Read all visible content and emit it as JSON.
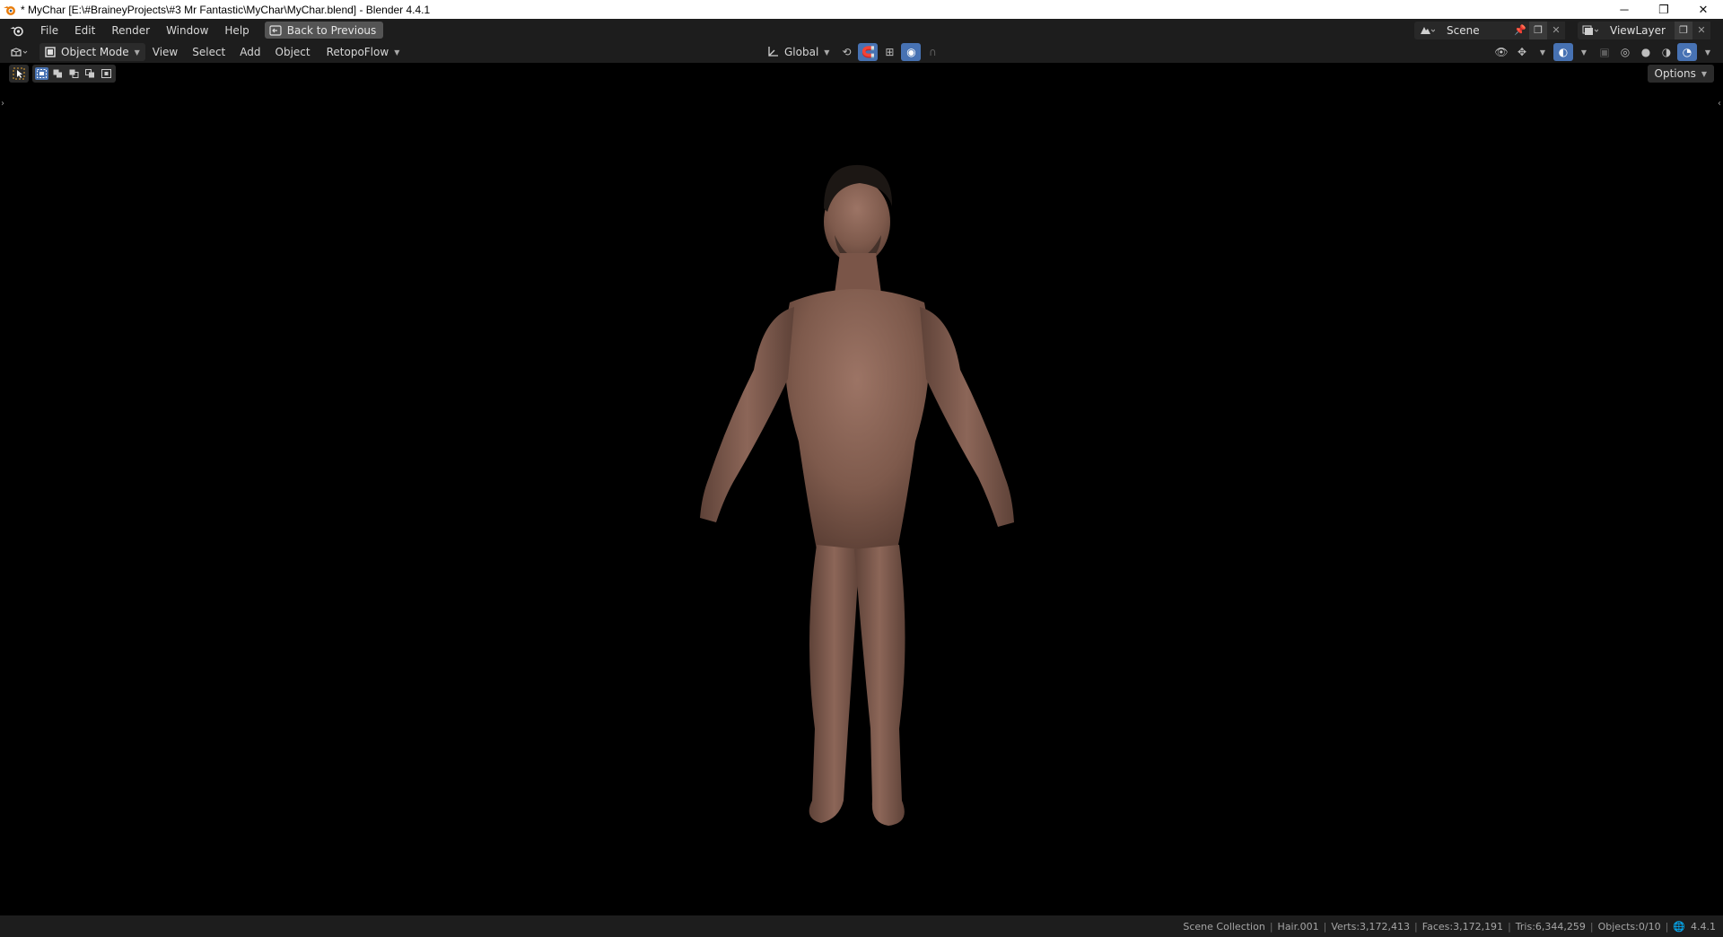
{
  "window": {
    "title": "* MyChar [E:\\#BraineyProjects\\#3 Mr Fantastic\\MyChar\\MyChar.blend] - Blender 4.4.1",
    "minimize_glyph": "─",
    "restore_glyph": "❐",
    "close_glyph": "✕"
  },
  "topbar": {
    "menus": [
      "File",
      "Edit",
      "Render",
      "Window",
      "Help"
    ],
    "back_button": "Back to Previous",
    "scene_name": "Scene",
    "view_layer_name": "ViewLayer"
  },
  "viewport_header": {
    "mode": "Object Mode",
    "menus": [
      "View",
      "Select",
      "Add",
      "Object"
    ],
    "addon_menu": "RetopoFlow",
    "transform_orientation": "Global"
  },
  "viewport": {
    "options_label": "Options",
    "shading_mode": "rendered",
    "selection_mode": "set-new"
  },
  "statusbar": {
    "collection": "Scene Collection",
    "active_object": "Hair.001",
    "verts": "Verts:3,172,413",
    "faces": "Faces:3,172,191",
    "tris": "Tris:6,344,259",
    "objects": "Objects:0/10",
    "version": "4.4.1"
  },
  "colors": {
    "ui_background": "#1d1d1d",
    "widget": "#2b2b2b",
    "accent_blue": "#4772b3",
    "viewport_bg": "#000000",
    "skin_tone": "#8a6456"
  }
}
